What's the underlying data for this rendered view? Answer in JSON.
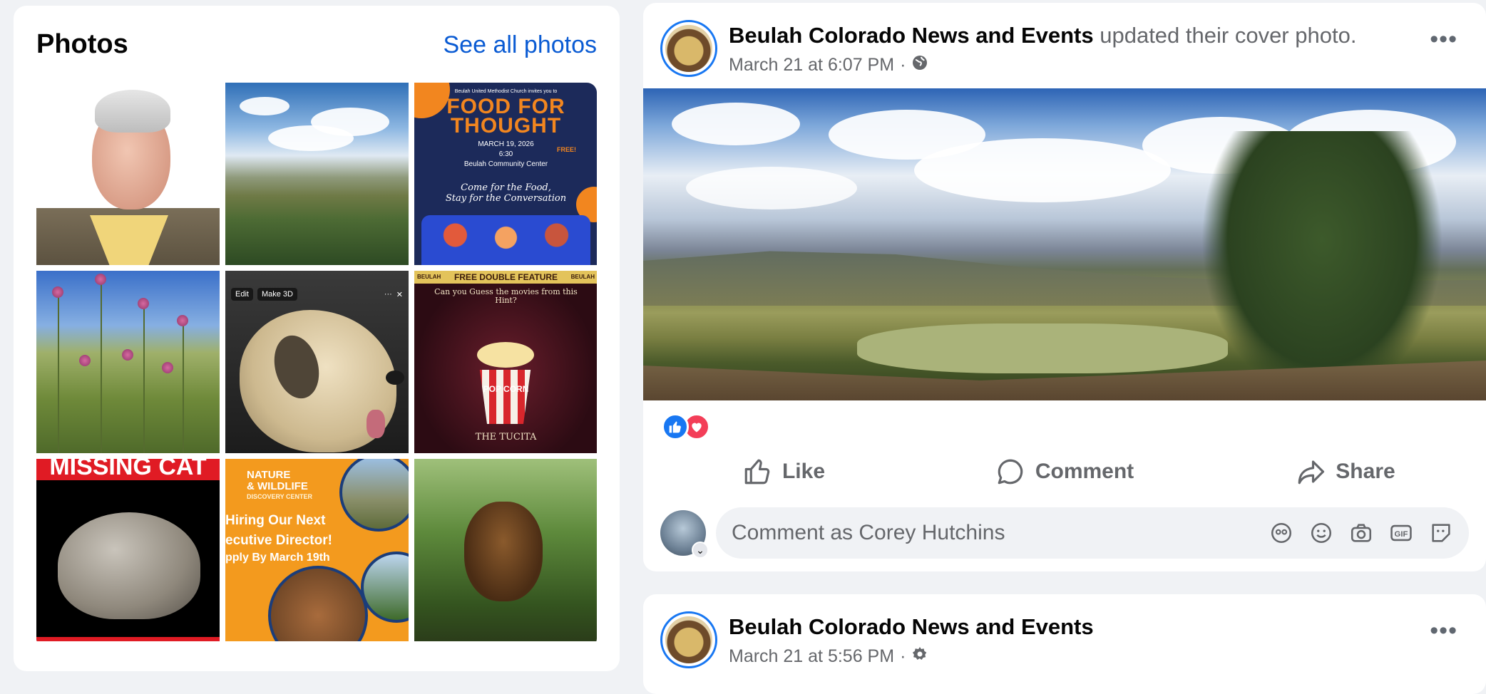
{
  "photos": {
    "title": "Photos",
    "see_all": "See all photos",
    "tiles": [
      {
        "alt": "portrait of older man"
      },
      {
        "alt": "mountain landscape"
      },
      {
        "kicker": "Beulah United Methodist Church invites you to",
        "headline_1": "FOOD FOR",
        "headline_2": "THOUGHT",
        "date": "MARCH 19, 2026",
        "time": "6:30",
        "venue": "Beulah Community Center",
        "script_1": "Come for the Food,",
        "script_2": "Stay for the Conversation",
        "badge": "FREE!"
      },
      {
        "alt": "thistles field"
      },
      {
        "toolbar_edit": "Edit",
        "toolbar_make3d": "Make 3D",
        "toolbar_more": "···",
        "toolbar_close": "✕"
      },
      {
        "brand_left": "BEULAH",
        "banner": "FREE DOUBLE FEATURE",
        "brand_right": "BEULAH",
        "line_1": "Can you Guess the movies from this Hint?",
        "popcorn": "POP CORN",
        "venue": "THE TUCITA"
      },
      {
        "banner": "MISSING CAT"
      },
      {
        "brand_1": "NATURE",
        "brand_2": "& WILDLIFE",
        "brand_3": "DISCOVERY CENTER",
        "line_1": "Hiring Our Next",
        "line_2": "ecutive Director!",
        "line_3": "pply By March 19th"
      },
      {
        "alt": "dog in forest"
      }
    ]
  },
  "post1": {
    "page_name": "Beulah Colorado News and Events",
    "action": "updated their cover photo.",
    "timestamp": "March 21 at 6:07 PM",
    "separator": "·",
    "more": "•••",
    "like": "Like",
    "comment": "Comment",
    "share": "Share",
    "comment_placeholder": "Comment as Corey Hutchins"
  },
  "post2": {
    "page_name": "Beulah Colorado News and Events",
    "timestamp": "March 21 at 5:56 PM",
    "separator": "·",
    "more": "•••"
  },
  "colors": {
    "accent": "#1877f2",
    "link": "#0a5bd3",
    "secondary_text": "#65676b",
    "background": "#f0f2f5",
    "love": "#f33e58"
  },
  "icons": [
    "globe-icon",
    "gear-icon",
    "like-reaction-icon",
    "love-reaction-icon",
    "thumbs-up-icon",
    "comment-bubble-icon",
    "share-arrow-icon",
    "avatar-sticker-icon",
    "emoji-icon",
    "camera-icon",
    "gif-icon",
    "sticker-icon",
    "chevron-down-icon"
  ]
}
